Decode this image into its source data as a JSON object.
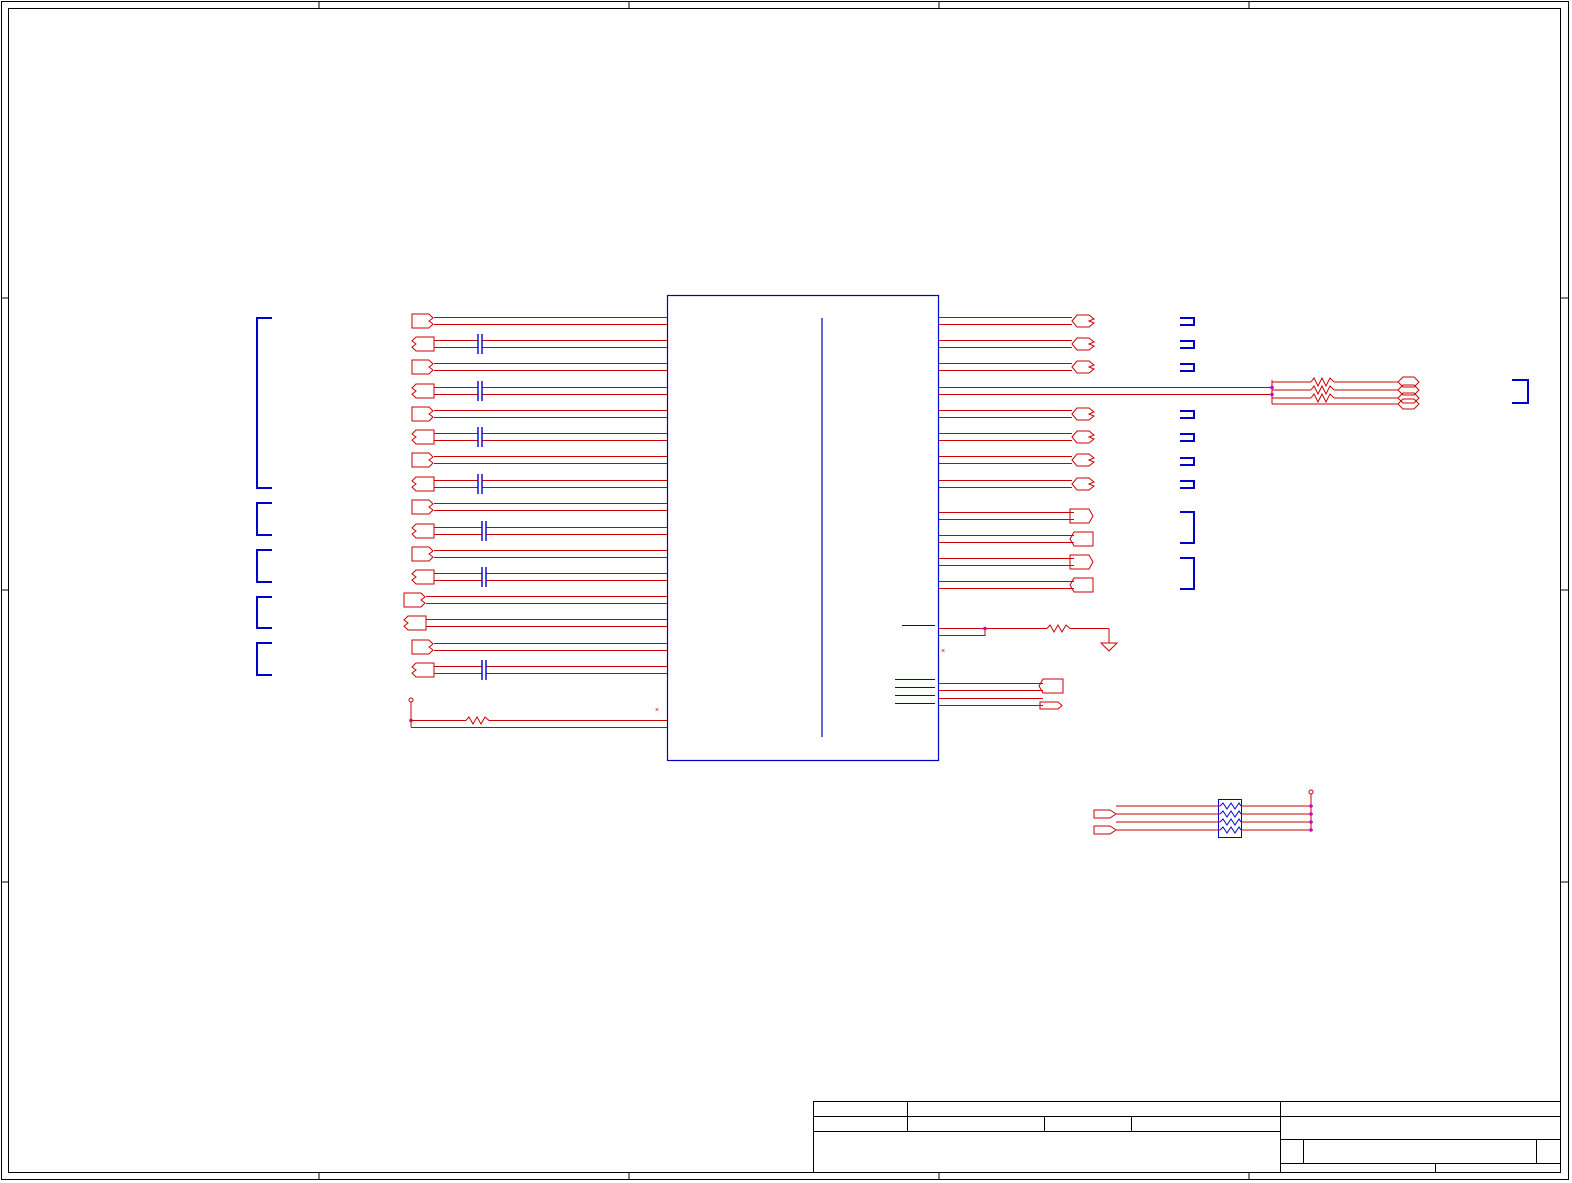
{
  "sheet": {
    "type": "schematic",
    "border_color": "#000000",
    "wire_color": "#cc0000",
    "component_color": "#0000cc",
    "junction_color": "#cc00cc"
  },
  "main_ic": {
    "left_pins": 20,
    "right_pins": 12,
    "stub_pins": 5
  },
  "left_nets": {
    "count": 16,
    "series_capacitors": 8
  },
  "right_nets": {
    "count": 12
  },
  "resistor_group": {
    "count": 3
  },
  "resistor_array": {
    "count": 4
  },
  "title_block": {
    "cells": []
  }
}
